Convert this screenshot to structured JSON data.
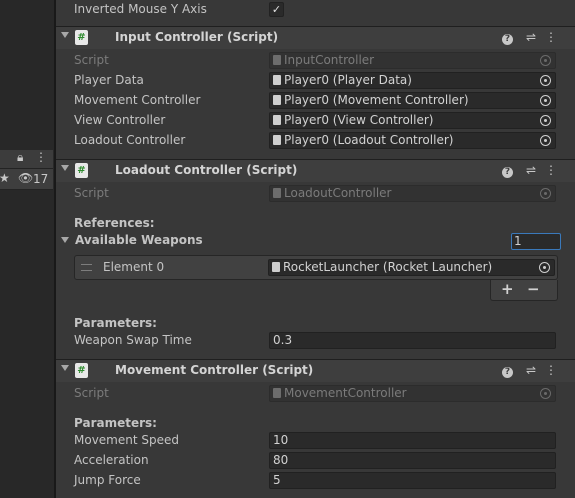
{
  "left_panel": {
    "hidden_count": "17"
  },
  "top_row": {
    "label": "Inverted Mouse Y Axis",
    "checked": true
  },
  "input_controller": {
    "title": "Input Controller (Script)",
    "rows": [
      {
        "label": "Script",
        "value": "InputController",
        "disabled": true
      },
      {
        "label": "Player Data",
        "value": "Player0 (Player Data)"
      },
      {
        "label": "Movement Controller",
        "value": "Player0 (Movement Controller)"
      },
      {
        "label": "View Controller",
        "value": "Player0 (View Controller)"
      },
      {
        "label": "Loadout Controller",
        "value": "Player0 (Loadout Controller)"
      }
    ]
  },
  "loadout_controller": {
    "title": "Loadout Controller (Script)",
    "script_label": "Script",
    "script_value": "LoadoutController",
    "references_label": "References:",
    "weapons_label": "Available Weapons",
    "weapons_size": "1",
    "element_label": "Element 0",
    "element_value": "RocketLauncher (Rocket Launcher)",
    "add_label": "+",
    "remove_label": "−",
    "parameters_label": "Parameters:",
    "swap_label": "Weapon Swap Time",
    "swap_value": "0.3"
  },
  "movement_controller": {
    "title": "Movement Controller (Script)",
    "script_label": "Script",
    "script_value": "MovementController",
    "parameters_label": "Parameters:",
    "rows": [
      {
        "label": "Movement Speed",
        "value": "10"
      },
      {
        "label": "Acceleration",
        "value": "80"
      },
      {
        "label": "Jump Force",
        "value": "5"
      }
    ]
  }
}
